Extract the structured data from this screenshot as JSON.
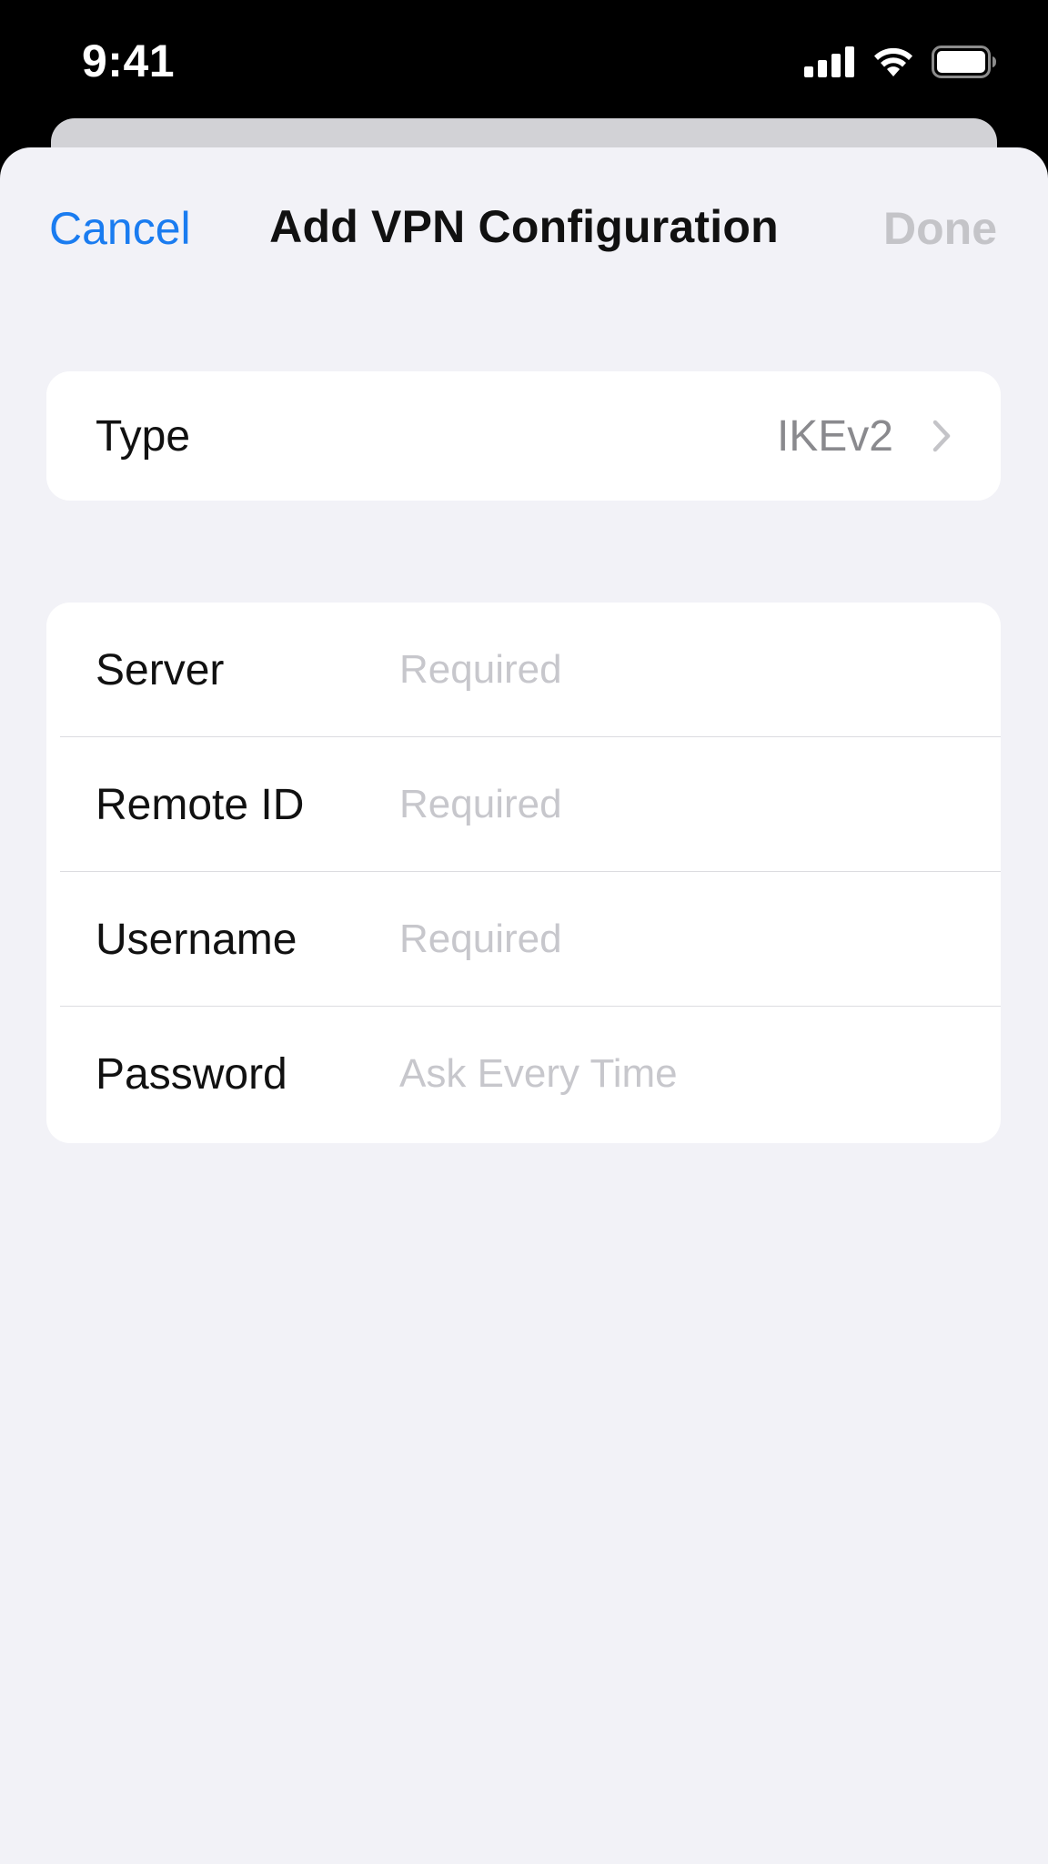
{
  "status_bar": {
    "time": "9:41"
  },
  "nav": {
    "cancel_label": "Cancel",
    "title": "Add VPN Configuration",
    "done_label": "Done"
  },
  "type_row": {
    "label": "Type",
    "value": "IKEv2"
  },
  "fields": [
    {
      "label": "Server",
      "value": "",
      "placeholder": "Required"
    },
    {
      "label": "Remote ID",
      "value": "",
      "placeholder": "Required"
    },
    {
      "label": "Username",
      "value": "",
      "placeholder": "Required"
    },
    {
      "label": "Password",
      "value": "",
      "placeholder": "Ask Every Time"
    }
  ],
  "colors": {
    "accent": "#1a7cf0",
    "disabled": "#c4c4c8",
    "background": "#f2f2f7",
    "placeholder": "#c7c7cc"
  },
  "icons": [
    "cellular-signal-icon",
    "wifi-icon",
    "battery-icon",
    "chevron-right-icon"
  ]
}
